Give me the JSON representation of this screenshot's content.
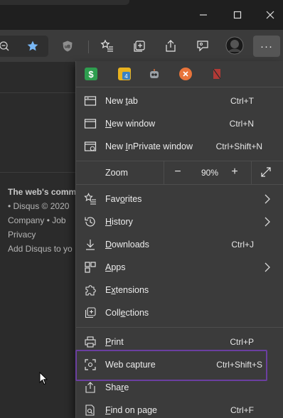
{
  "titlebar": {
    "minimize_icon": "minimize-icon",
    "maximize_icon": "maximize-icon",
    "close_icon": "close-icon"
  },
  "toolbar": {
    "icons": [
      "zoom-out-icon",
      "favorite-star-icon",
      "extension-shield-icon",
      "favorites-list-icon",
      "collections-icon",
      "share-icon",
      "feedback-icon",
      "profile-avatar",
      "more-icon"
    ],
    "more_label": "···"
  },
  "page": {
    "lines": [
      "The web's comm",
      "• Disqus © 2020",
      "Company  •  Job",
      "Privacy",
      "Add Disqus to yo"
    ]
  },
  "menu": {
    "extensions": [
      {
        "name": "extension-green-icon",
        "color": "#2e9e4f"
      },
      {
        "name": "extension-yellow-icon",
        "color": "#e8b21f"
      },
      {
        "name": "extension-robot-icon",
        "color": "#9aa0a6"
      },
      {
        "name": "extension-orange-icon",
        "color": "#e8743b"
      },
      {
        "name": "extension-red-icon",
        "color": "#b13a36"
      }
    ],
    "items": [
      {
        "label": "New tab",
        "underline": "t",
        "shortcut": "Ctrl+T"
      },
      {
        "label": "New window",
        "underline": "N",
        "shortcut": "Ctrl+N"
      },
      {
        "label": "New InPrivate window",
        "underline": "I",
        "shortcut": "Ctrl+Shift+N"
      },
      {
        "label": "Favorites",
        "underline": "o",
        "shortcut": ""
      },
      {
        "label": "History",
        "underline": "H",
        "shortcut": ""
      },
      {
        "label": "Downloads",
        "underline": "D",
        "shortcut": "Ctrl+J"
      },
      {
        "label": "Apps",
        "underline": "A",
        "shortcut": ""
      },
      {
        "label": "Extensions",
        "underline": "x",
        "shortcut": ""
      },
      {
        "label": "Collections",
        "underline": "e",
        "shortcut": ""
      },
      {
        "label": "Print",
        "underline": "P",
        "shortcut": "Ctrl+P"
      },
      {
        "label": "Web capture",
        "underline": "",
        "shortcut": "Ctrl+Shift+S"
      },
      {
        "label": "Share",
        "underline": "r",
        "shortcut": ""
      },
      {
        "label": "Find on page",
        "underline": "F",
        "shortcut": "Ctrl+F"
      }
    ],
    "zoom": {
      "label": "Zoom",
      "value": "90%",
      "minus": "−",
      "plus": "+"
    },
    "highlight_color": "#6b3fa0"
  }
}
